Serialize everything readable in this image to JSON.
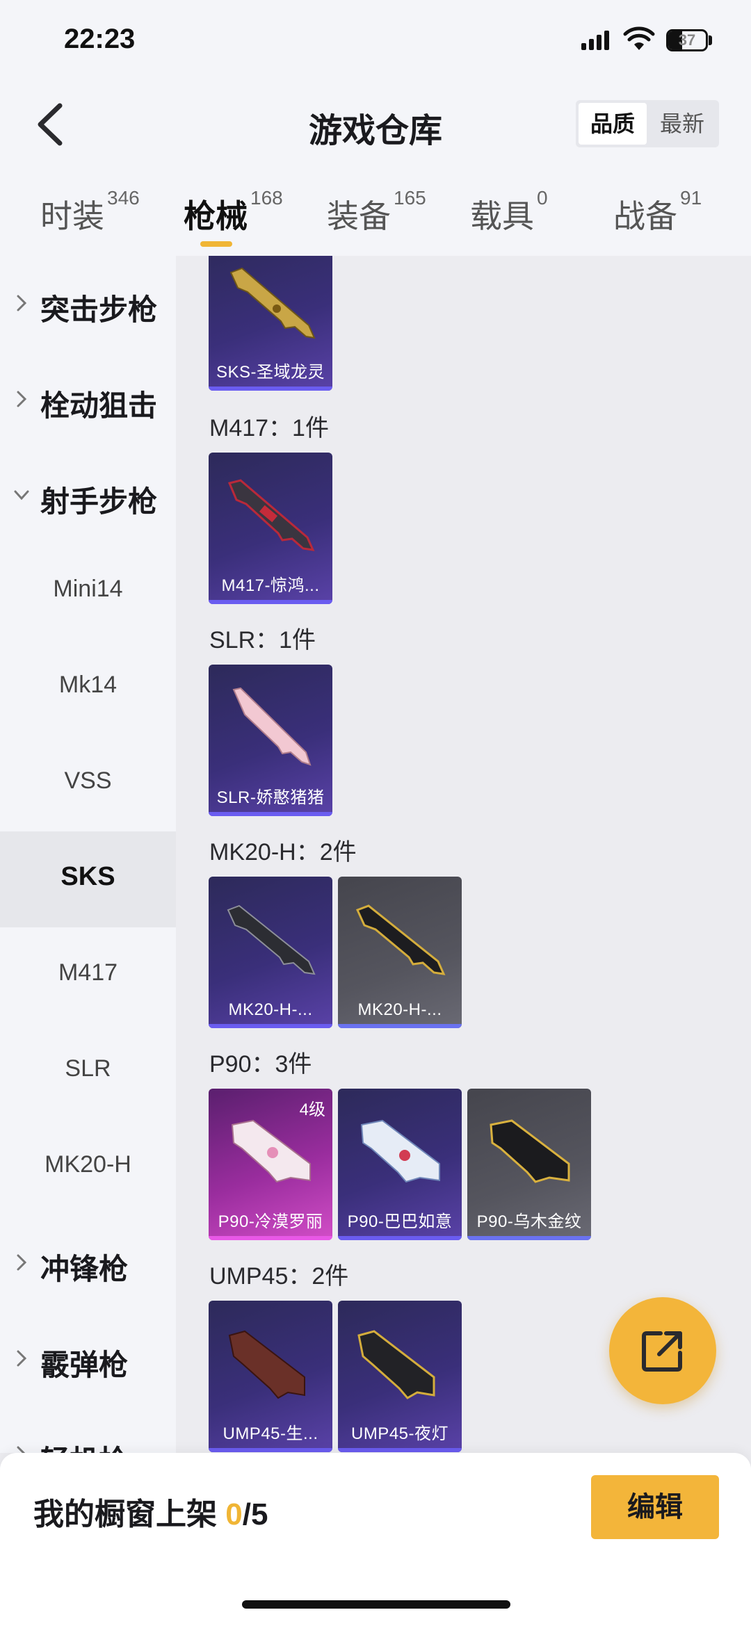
{
  "status": {
    "time": "22:23",
    "battery": "37"
  },
  "nav": {
    "title": "游戏仓库",
    "sort_options": [
      "品质",
      "最新"
    ]
  },
  "tabs": [
    {
      "label": "时装",
      "count": "346"
    },
    {
      "label": "枪械",
      "count": "168"
    },
    {
      "label": "装备",
      "count": "165"
    },
    {
      "label": "载具",
      "count": "0"
    },
    {
      "label": "战备",
      "count": "91"
    }
  ],
  "sidebar": {
    "groups": [
      "突击步枪",
      "栓动狙击",
      "射手步枪",
      "冲锋枪",
      "霰弹枪",
      "轻机枪"
    ],
    "subitems": [
      "Mini14",
      "Mk14",
      "VSS",
      "SKS",
      "M417",
      "SLR",
      "MK20-H"
    ]
  },
  "sections": [
    {
      "title": "M417：1件"
    },
    {
      "title": "SLR：1件"
    },
    {
      "title": "MK20-H：2件"
    },
    {
      "title": "P90：3件"
    },
    {
      "title": "UMP45：2件"
    }
  ],
  "cards": {
    "sks": [
      "SKS-圣域龙灵"
    ],
    "m417": [
      "M417-惊鸿..."
    ],
    "slr": [
      "SLR-娇憨猪猪"
    ],
    "mk20": [
      "MK20-H-...",
      "MK20-H-..."
    ],
    "p90": [
      "P90-冷漠罗丽",
      "P90-巴巴如意",
      "P90-乌木金纹"
    ],
    "p90_level": "4级",
    "ump": [
      "UMP45-生...",
      "UMP45-夜灯"
    ]
  },
  "bottom": {
    "label": "我的橱窗上架 ",
    "count": "0",
    "total": "/5",
    "edit": "编辑"
  },
  "colors": {
    "accent": "#f3b53a",
    "purple_card": "#3a2f7a",
    "gray_card": "#55555e",
    "pink_card": "#9a2d9e"
  }
}
